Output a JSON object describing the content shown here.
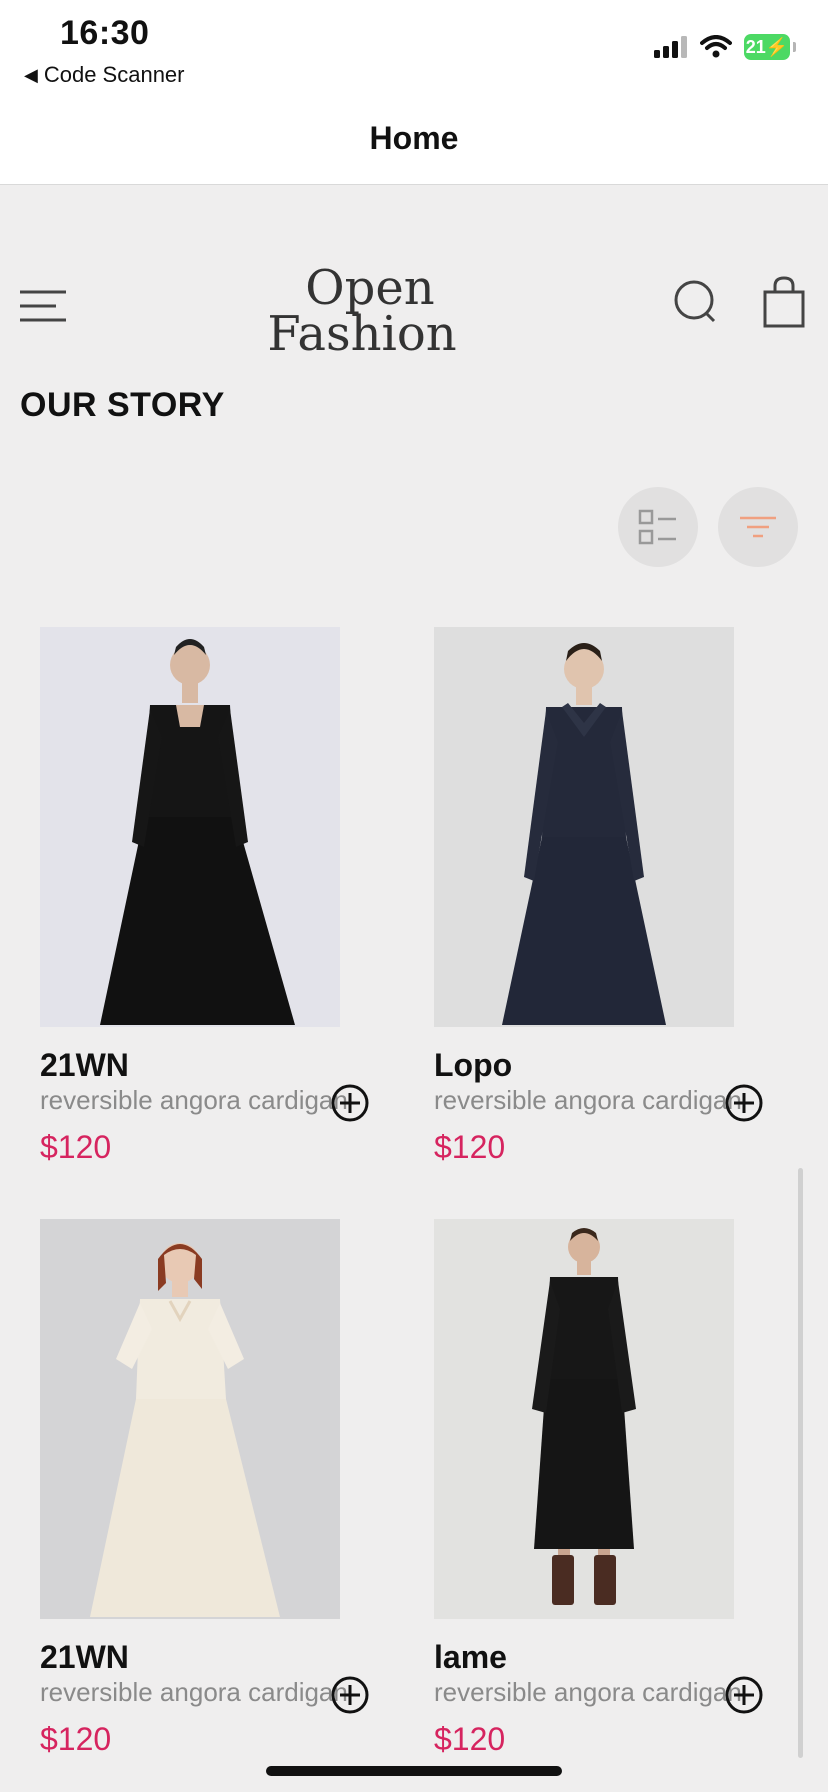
{
  "status_bar": {
    "time": "16:30",
    "back_app": "Code Scanner",
    "battery": "21"
  },
  "nav": {
    "title": "Home"
  },
  "brand": {
    "logo_line1": "Open",
    "logo_line2": "Fashion"
  },
  "section": {
    "title": "OUR STORY"
  },
  "colors": {
    "price": "#d6245f",
    "filter_accent": "#f0a080",
    "background": "#efeeee"
  },
  "icons": [
    "menu-icon",
    "search-icon",
    "shopping-bag-icon",
    "list-view-icon",
    "filter-icon",
    "add-circle-icon",
    "wifi-icon",
    "signal-icon",
    "battery-icon"
  ],
  "products": [
    {
      "name": "21WN",
      "description": "reversible angora cardigan",
      "price": "$120"
    },
    {
      "name": "Lopo",
      "description": "reversible angora cardigan",
      "price": "$120"
    },
    {
      "name": "21WN",
      "description": "reversible angora cardigan",
      "price": "$120"
    },
    {
      "name": "lame",
      "description": "reversible angora cardigan",
      "price": "$120"
    }
  ]
}
